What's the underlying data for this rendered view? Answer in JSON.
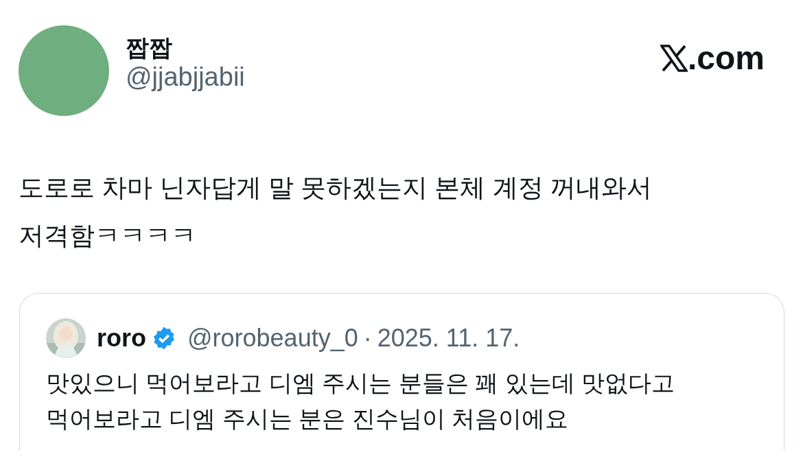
{
  "author": {
    "name": "짭짭",
    "handle": "@jjabjjabii"
  },
  "site": {
    "label": ".com"
  },
  "tweet": {
    "text": "도로로 차마 닌자답게 말 못하겠는지 본체 계정 꺼내와서 저격함ㅋㅋㅋㅋ"
  },
  "quote": {
    "name": "roro",
    "verified": true,
    "handle": "@rorobeauty_0",
    "separator": "·",
    "date": "2025. 11. 17.",
    "text": "맛있으니 먹어보라고 디엠 주시는 분들은 꽤 있는데 맛없다고 먹어보라고 디엠 주시는 분은 진수님이 처음이에요"
  }
}
